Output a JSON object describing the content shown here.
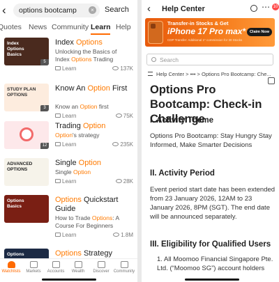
{
  "left": {
    "search": {
      "query": "options bootcamp",
      "clear_icon": "clear-circle-icon",
      "button": "Search"
    },
    "tabs": [
      {
        "label": "Quotes",
        "active": false
      },
      {
        "label": "News",
        "active": false
      },
      {
        "label": "Community",
        "active": false
      },
      {
        "label": "Learn",
        "active": true
      },
      {
        "label": "Help",
        "active": false
      }
    ],
    "courses": [
      {
        "thumb_text": [
          "Index",
          "Options",
          "Basics"
        ],
        "thumb_bg": "#4a2a1e",
        "thumb_color": "#ffffff",
        "badge": "5",
        "title_plain_1": "Index ",
        "title_hl": "Options",
        "title_plain_2": "",
        "sub_1": "Unlocking the Basics of",
        "sub_2a": "Index ",
        "sub_2hl": "Options",
        "sub_2b": " Trading",
        "type": "Learn",
        "views": "137K"
      },
      {
        "thumb_text": [
          "STUDY PLAN",
          "OPTIONS"
        ],
        "thumb_bg": "#fdecde",
        "thumb_color": "#333333",
        "badge": "3",
        "title_plain_1": "Know An ",
        "title_hl": "Option",
        "title_plain_2": " First",
        "sub_1": "",
        "sub_2a": "Know an ",
        "sub_2hl": "Option",
        "sub_2b": " first",
        "type": "Learn",
        "views": "75K"
      },
      {
        "thumb_text": [],
        "thumb_bg": "#fde8ea",
        "thumb_color": "#333333",
        "badge": "12",
        "title_plain_1": "Trading ",
        "title_hl": "Option",
        "title_plain_2": "",
        "sub_1": "",
        "sub_2a": "",
        "sub_2hl": "Option",
        "sub_2b": "'s strategy",
        "type": "Learn",
        "views": "235K"
      },
      {
        "thumb_text": [
          "ADVANCED",
          "OPTIONS"
        ],
        "thumb_bg": "#f6f3ea",
        "thumb_color": "#222222",
        "badge": "",
        "title_plain_1": "Single ",
        "title_hl": "Option",
        "title_plain_2": "",
        "sub_1": "",
        "sub_2a": "Single ",
        "sub_2hl": "Option",
        "sub_2b": "",
        "type": "Learn",
        "views": "28K"
      },
      {
        "thumb_text": [
          "Options",
          "Basics"
        ],
        "thumb_bg": "#7a1f14",
        "thumb_color": "#ffffff",
        "badge": "",
        "title_plain_1": "",
        "title_hl": "Options",
        "title_plain_2": " Quickstart Guide",
        "sub_1": "",
        "sub_2a": "How to Trade ",
        "sub_2hl": "Options",
        "sub_2b": ": A Course For Beginners",
        "type": "Learn",
        "views": "1.8M"
      },
      {
        "thumb_text": [
          "Options"
        ],
        "thumb_bg": "#1c2a44",
        "thumb_color": "#ffffff",
        "badge": "",
        "title_plain_1": "",
        "title_hl": "Options",
        "title_plain_2": " Strategy",
        "sub_1": "",
        "sub_2a": "",
        "sub_2hl": "",
        "sub_2b": "",
        "type": "",
        "views": ""
      }
    ],
    "nav": [
      {
        "label": "Watchlists",
        "icon": "watchlist-icon",
        "active": true
      },
      {
        "label": "Markets",
        "icon": "markets-icon",
        "active": false
      },
      {
        "label": "Accounts",
        "icon": "accounts-icon",
        "active": false
      },
      {
        "label": "Wealth",
        "icon": "wealth-icon",
        "active": false
      },
      {
        "label": "Discover",
        "icon": "discover-icon",
        "active": false
      },
      {
        "label": "Community",
        "icon": "community-icon",
        "active": false
      }
    ],
    "accent": "#ff6a00"
  },
  "right": {
    "header": {
      "title": "Help Center",
      "badge": "10"
    },
    "banner": {
      "line1": "Transfer-in Stocks & Get",
      "line2": "iPhone 17 Pro max*",
      "line3": "CDP Transfer: Additional 1* commission for 30 Stocks",
      "cta": "Claim Now",
      "color": "#f0701a"
    },
    "search_placeholder": "Search",
    "breadcrumb": "Help Center  >  •••  >  Options Pro Bootcamp: Che...",
    "article": {
      "title": "Options Pro Bootcamp: Check-in Challenge",
      "s1_heading": "I. Activity Theme",
      "s1_body": "Options Pro Bootcamp: Stay Hungry Stay Informed, Make Smarter Decisions",
      "s2_heading": "II. Activity Period",
      "s2_body": "Event period start date has been extended from 23 January 2026, 12AM to 23 January 2026, 8PM (SGT). The end date will be announced separately.",
      "s3_heading": "III. Eligibility for Qualified Users",
      "s3_item1": "1. All Moomoo Financial Singapore Pte. Ltd. (“Moomoo SG”) account holders"
    }
  }
}
